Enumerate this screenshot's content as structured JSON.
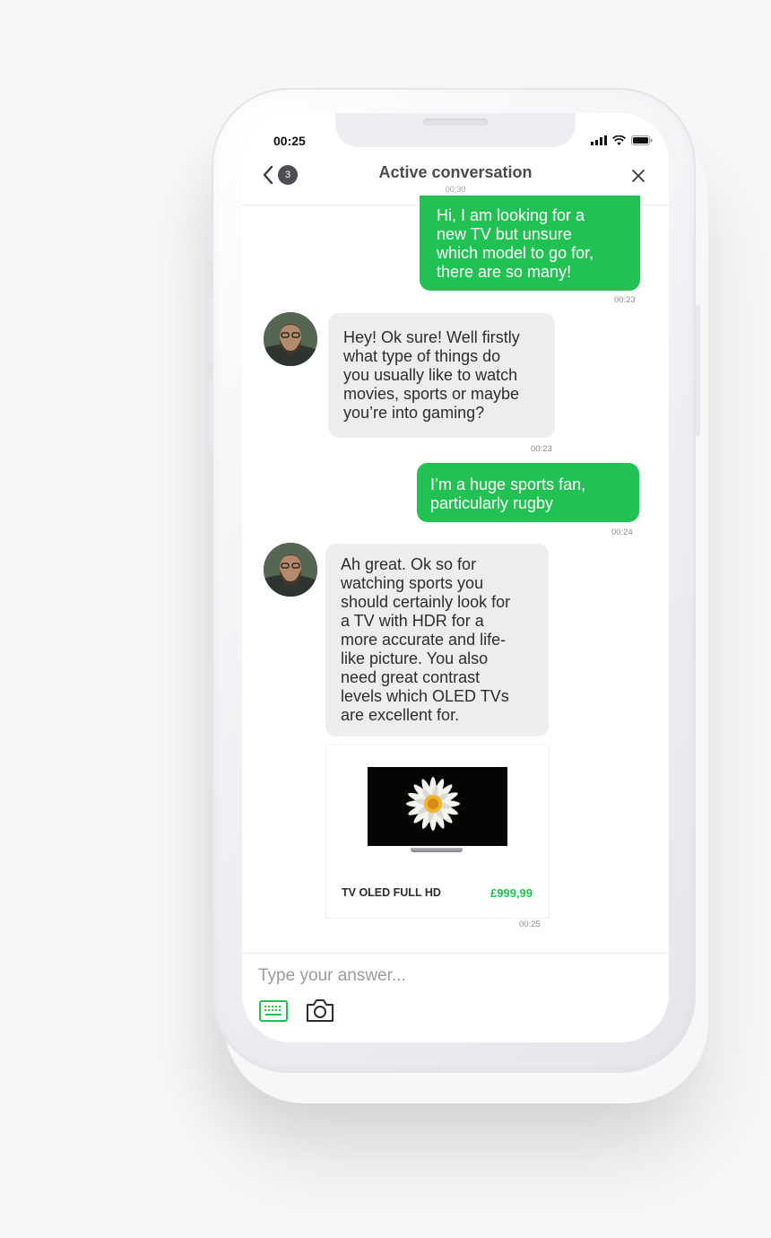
{
  "status_bar": {
    "time": "00:25"
  },
  "header": {
    "title": "Active conversation",
    "subtitle": "00:30",
    "unread_count": "3"
  },
  "messages": [
    {
      "from": "user",
      "text": "Hi, I am looking for a\nnew TV but unsure\nwhich model to go for,\nthere are so many!",
      "time": "00:23"
    },
    {
      "from": "agent",
      "text": "Hey! Ok sure! Well firstly\nwhat type of things do\nyou usually like to watch\nmovies, sports or maybe\nyou’re into gaming?",
      "time": "00:23"
    },
    {
      "from": "user",
      "text": "I’m a huge sports fan,\nparticularly rugby",
      "time": "00:24"
    },
    {
      "from": "agent",
      "text": "Ah great. Ok so for\nwatching sports you\nshould certainly look for\na TV with HDR for a\nmore accurate and life-\nlike picture. You also\nneed great contrast\nlevels which OLED TVs\nare excellent for.",
      "time": ""
    }
  ],
  "product_card": {
    "name": "TV OLED FULL HD",
    "price": "£999,99",
    "time": "00:25"
  },
  "composer": {
    "placeholder": "Type your answer...",
    "keyboard_icon": "keyboard-icon",
    "camera_icon": "camera-icon"
  },
  "colors": {
    "accent": "#21c153",
    "incoming_bubble": "#ededef",
    "text_dark": "#2d2d30"
  }
}
